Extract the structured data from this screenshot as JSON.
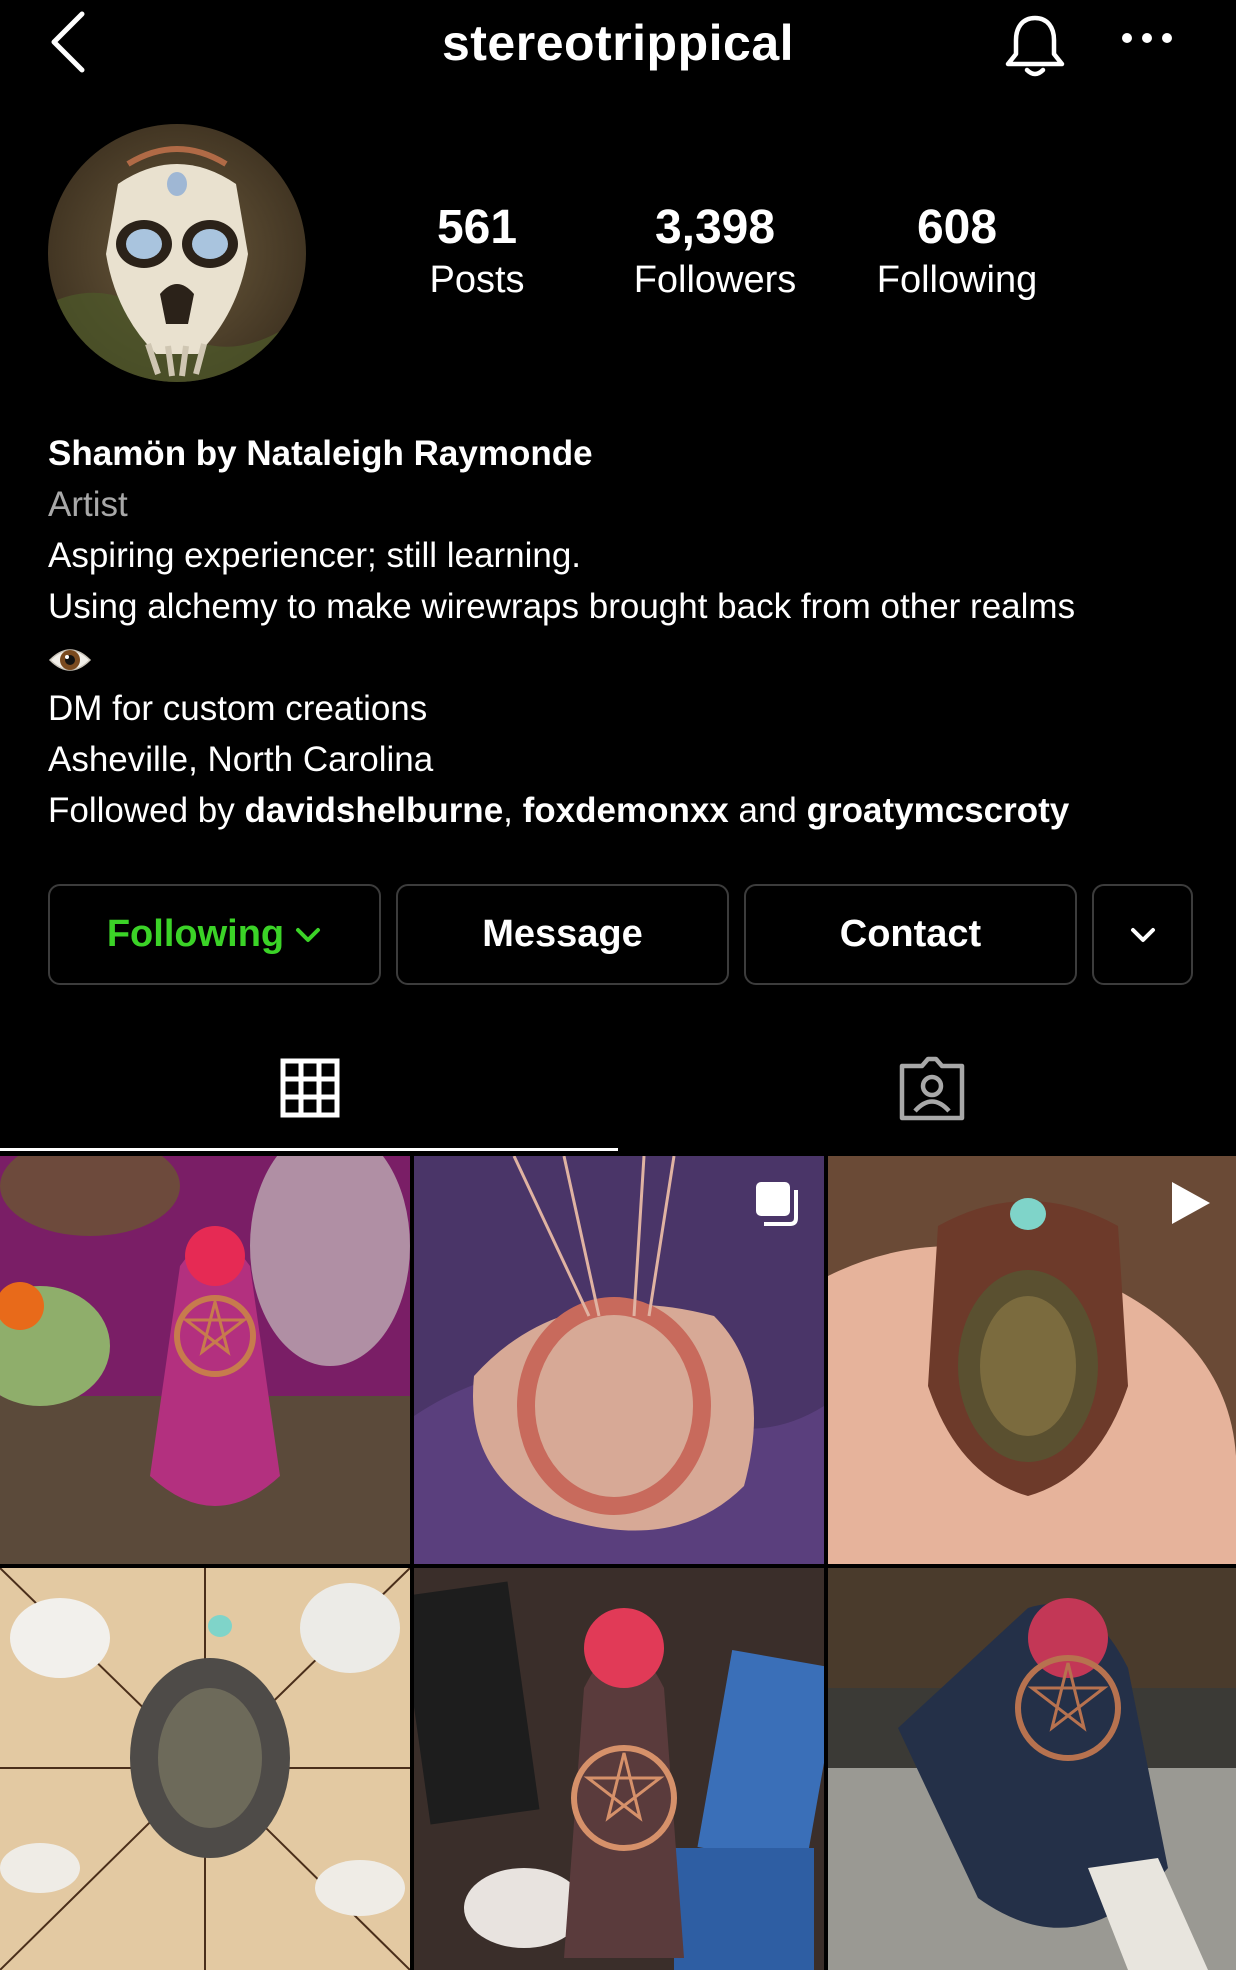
{
  "header": {
    "username": "stereotrippical"
  },
  "stats": {
    "posts_count": "561",
    "posts_label": "Posts",
    "followers_count": "3,398",
    "followers_label": "Followers",
    "following_count": "608",
    "following_label": "Following"
  },
  "bio": {
    "name": "Shamön by Nataleigh Raymonde",
    "category": "Artist",
    "line1": "Aspiring experiencer; still learning.",
    "line2": "Using alchemy to make wirewraps brought back from other realms",
    "line3": "DM for custom creations",
    "location": "Asheville, North Carolina",
    "followed_by_prefix": "Followed by ",
    "followed_user_1": "davidshelburne",
    "followed_sep": ", ",
    "followed_user_2": "foxdemonxx",
    "followed_and": " and ",
    "followed_user_3": "groatymcscroty"
  },
  "actions": {
    "following_label": "Following",
    "message_label": "Message",
    "contact_label": "Contact"
  },
  "colors": {
    "following_green": "#3bd327",
    "muted_text": "#a8a8a8",
    "border": "#3c3c3c"
  },
  "icons": {
    "back": "back-chevron-icon",
    "notifications": "bell-icon",
    "more": "more-icon",
    "grid_tab": "grid-icon",
    "tagged_tab": "tagged-icon",
    "multi_post": "carousel-icon",
    "video_post": "play-icon"
  },
  "posts": [
    {
      "badge": "none"
    },
    {
      "badge": "carousel-icon"
    },
    {
      "badge": "play-icon"
    },
    {
      "badge": "none"
    },
    {
      "badge": "none"
    },
    {
      "badge": "none"
    }
  ]
}
